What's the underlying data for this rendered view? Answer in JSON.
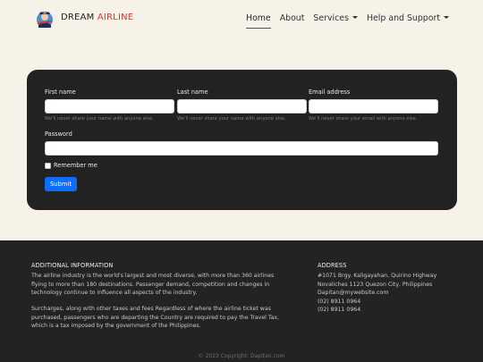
{
  "navbar": {
    "brand_main": "DREAM",
    "brand_accent": "AIRLINE",
    "links": [
      {
        "label": "Home"
      },
      {
        "label": "About"
      },
      {
        "label": "Services"
      },
      {
        "label": "Help and Support"
      }
    ]
  },
  "form": {
    "first_name": {
      "label": "First name",
      "value": "",
      "help": "We'll never share your name with anyone else."
    },
    "last_name": {
      "label": "Last name",
      "value": "",
      "help": "We'll never share your name with anyone else."
    },
    "email": {
      "label": "Email address",
      "value": "",
      "help": "We'll never share your email with anyone else."
    },
    "password": {
      "label": "Password",
      "value": ""
    },
    "remember_label": "Remember me",
    "remember_checked": false,
    "submit_label": "Submit"
  },
  "footer": {
    "info_heading": "ADDITIONAL INFORMATION",
    "info_p1_lines": [
      "The airline industry is the world's largest and most diverse, with more than 360 airlines",
      "flying to more than 180 destinations. Passenger demand, competition and changes in",
      "technology continue to influence all aspects of the industry."
    ],
    "info_p2_lines": [
      "Surcharges, along with other taxes and fees Regardless of where the airline ticket was",
      "purchased, passengers who are departing the Country are required to pay the Travel Tax,",
      "which is a tax imposed by the government of the Philippines."
    ],
    "address_heading": "ADDRESS",
    "address_lines": [
      "#1071 Brgy. Kaligayahan, Quirino Highway",
      "Novaliches 1123 Quezon City, Philippines",
      "Dapitan@mywebsite.com",
      "(02) 8911 0964",
      "(02) 8911 0964"
    ],
    "copyright": "© 2023 Copyright: Dapitan.com"
  },
  "colors": {
    "page_bg": "#f6f2e8",
    "card_bg": "#222222",
    "footer_bg": "#232323",
    "brand_accent": "#d4392f",
    "button_primary": "#0d6efd"
  }
}
